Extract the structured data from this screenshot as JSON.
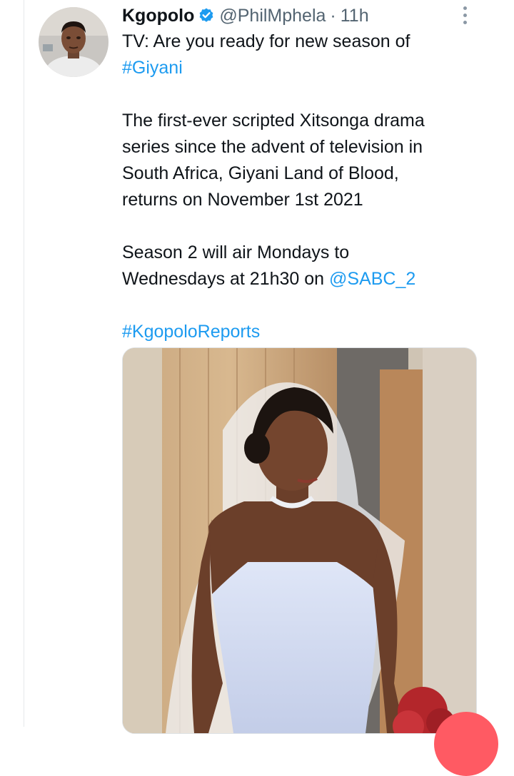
{
  "tweet": {
    "author_name": "Kgopolo",
    "handle": "@PhilMphela",
    "separator": "·",
    "time": "11h",
    "line1_text": "TV: Are you ready for new season of",
    "hashtag_giyani": "#Giyani",
    "paragraph2": [
      "The first-ever scripted Xitsonga drama",
      "series since the advent of television in",
      "South Africa, Giyani Land of Blood,",
      "returns on November 1st 2021"
    ],
    "paragraph3_line1": "Season 2 will air Mondays to",
    "paragraph3_line2_text": "Wednesdays at 21h30 on ",
    "mention": "@SABC_2",
    "hashtag_reports": "#KgopoloReports"
  },
  "icons": {
    "verified": "verified-badge-icon",
    "more": "more-options-icon"
  },
  "colors": {
    "link": "#1d9bf0",
    "text": "#0f1419",
    "secondary": "#536471",
    "verified": "#1d9bf0"
  }
}
